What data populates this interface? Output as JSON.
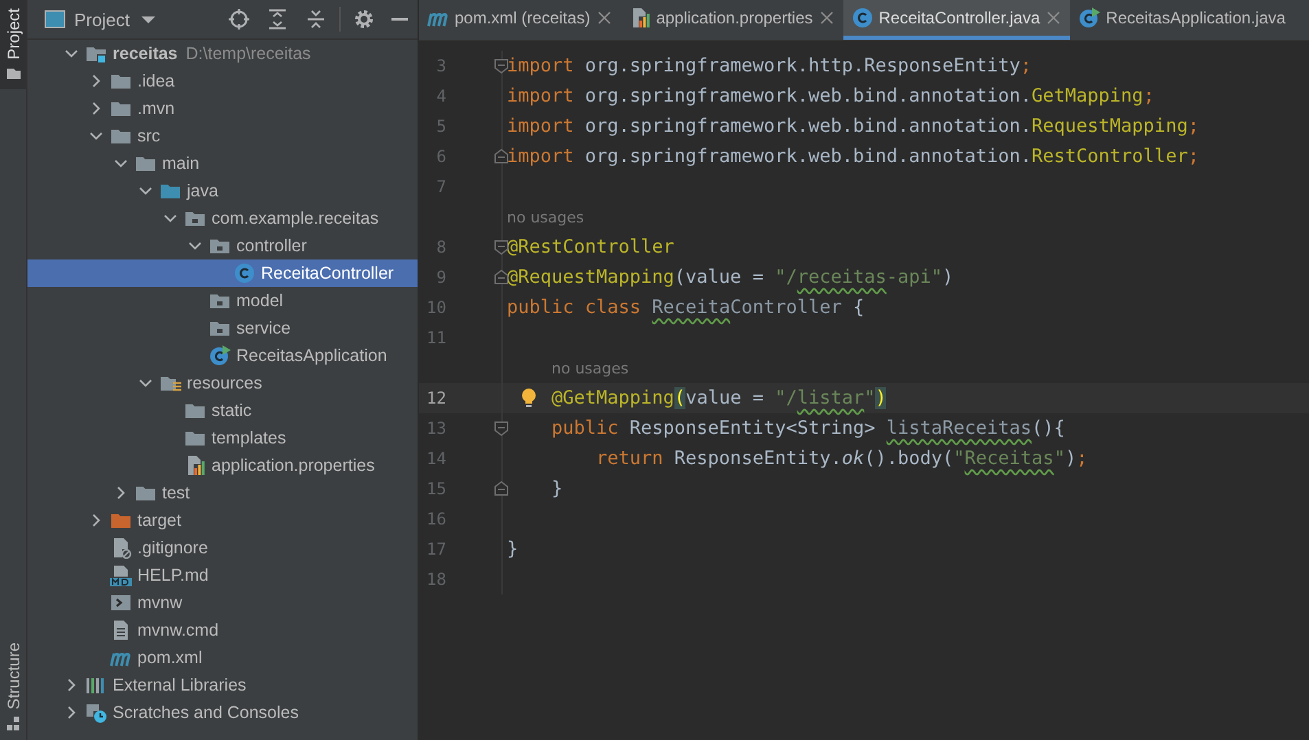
{
  "tool_strip": [
    {
      "label": "Project",
      "selected": true
    },
    {
      "label": "Structure",
      "selected": false
    }
  ],
  "project_panel": {
    "view": "Project",
    "tree": [
      {
        "label": "receitas",
        "path": "D:\\temp\\receitas",
        "kind": "module",
        "expanded": true,
        "selected": false,
        "children": [
          {
            "label": ".idea",
            "kind": "folder",
            "expanded": false,
            "selected": false
          },
          {
            "label": ".mvn",
            "kind": "folder",
            "expanded": false,
            "selected": false
          },
          {
            "label": "src",
            "kind": "folder",
            "expanded": true,
            "selected": false,
            "children": [
              {
                "label": "main",
                "kind": "folder",
                "expanded": true,
                "selected": false,
                "children": [
                  {
                    "label": "java",
                    "kind": "source-folder",
                    "expanded": true,
                    "selected": false,
                    "children": [
                      {
                        "label": "com.example.receitas",
                        "kind": "package",
                        "expanded": true,
                        "selected": false,
                        "children": [
                          {
                            "label": "controller",
                            "kind": "package",
                            "expanded": true,
                            "selected": false,
                            "children": [
                              {
                                "label": "ReceitaController",
                                "kind": "class",
                                "selected": true
                              }
                            ]
                          },
                          {
                            "label": "model",
                            "kind": "package",
                            "selected": false
                          },
                          {
                            "label": "service",
                            "kind": "package",
                            "selected": false
                          },
                          {
                            "label": "ReceitasApplication",
                            "kind": "app-class",
                            "selected": false
                          }
                        ]
                      }
                    ]
                  },
                  {
                    "label": "resources",
                    "kind": "resources-folder",
                    "expanded": true,
                    "selected": false,
                    "children": [
                      {
                        "label": "static",
                        "kind": "folder",
                        "selected": false
                      },
                      {
                        "label": "templates",
                        "kind": "folder",
                        "selected": false
                      },
                      {
                        "label": "application.properties",
                        "kind": "properties",
                        "selected": false
                      }
                    ]
                  }
                ]
              },
              {
                "label": "test",
                "kind": "folder",
                "expanded": false,
                "selected": false
              }
            ]
          },
          {
            "label": "target",
            "kind": "excluded-folder",
            "expanded": false,
            "selected": false
          },
          {
            "label": ".gitignore",
            "kind": "ignore-file",
            "selected": false
          },
          {
            "label": "HELP.md",
            "kind": "markdown",
            "selected": false
          },
          {
            "label": "mvnw",
            "kind": "shell",
            "selected": false
          },
          {
            "label": "mvnw.cmd",
            "kind": "text-file",
            "selected": false
          },
          {
            "label": "pom.xml",
            "kind": "maven",
            "selected": false
          }
        ]
      },
      {
        "label": "External Libraries",
        "kind": "libraries",
        "expanded": false,
        "selected": false
      },
      {
        "label": "Scratches and Consoles",
        "kind": "scratches",
        "expanded": false,
        "selected": false
      }
    ]
  },
  "editor_tabs": [
    {
      "label": "pom.xml (receitas)",
      "kind": "maven",
      "selected": false,
      "close_button": true
    },
    {
      "label": "application.properties",
      "kind": "properties",
      "selected": false,
      "close_button": true
    },
    {
      "label": "ReceitaController.java",
      "kind": "class",
      "selected": true,
      "close_button": true
    },
    {
      "label": "ReceitasApplication.java",
      "kind": "app-class",
      "selected": false,
      "close_button": false
    }
  ],
  "editor": {
    "lines": [
      {
        "number": "3",
        "kind": "fold-start",
        "tokens": [
          {
            "kind": "keyword",
            "text": "import"
          },
          {
            "kind": "plain",
            "text": " org.springframework.http.ResponseEntity"
          },
          {
            "kind": "keyword",
            "text": ";"
          }
        ]
      },
      {
        "number": "4",
        "kind": "code",
        "tokens": [
          {
            "kind": "keyword",
            "text": "import"
          },
          {
            "kind": "plain",
            "text": " org.springframework.web.bind.annotation."
          },
          {
            "kind": "annotation",
            "text": "GetMapping"
          },
          {
            "kind": "keyword",
            "text": ";"
          }
        ]
      },
      {
        "number": "5",
        "kind": "code",
        "tokens": [
          {
            "kind": "keyword",
            "text": "import"
          },
          {
            "kind": "plain",
            "text": " org.springframework.web.bind.annotation."
          },
          {
            "kind": "annotation",
            "text": "RequestMapping"
          },
          {
            "kind": "keyword",
            "text": ";"
          }
        ]
      },
      {
        "number": "6",
        "kind": "fold-end",
        "tokens": [
          {
            "kind": "keyword",
            "text": "import"
          },
          {
            "kind": "plain",
            "text": " org.springframework.web.bind.annotation."
          },
          {
            "kind": "annotation",
            "text": "RestController"
          },
          {
            "kind": "keyword",
            "text": ";"
          }
        ]
      },
      {
        "number": "7",
        "kind": "code"
      },
      {
        "number": "8",
        "kind": "fold-start",
        "hint": "no usages",
        "tokens": [
          {
            "kind": "annotation",
            "text": "@RestController"
          }
        ]
      },
      {
        "number": "9",
        "kind": "fold-end",
        "tokens": [
          {
            "kind": "annotation",
            "text": "@RequestMapping"
          },
          {
            "kind": "plain",
            "text": "(value = "
          },
          {
            "kind": "string",
            "text": "\"/"
          },
          {
            "kind": "string",
            "text": "receitas",
            "typo": true
          },
          {
            "kind": "string",
            "text": "-api\""
          },
          {
            "kind": "plain",
            "text": ")"
          }
        ]
      },
      {
        "number": "10",
        "kind": "code",
        "tokens": [
          {
            "kind": "keyword",
            "text": "public class "
          },
          {
            "kind": "unused",
            "text": "Receita",
            "typo": true
          },
          {
            "kind": "unused",
            "text": "Controller"
          },
          {
            "kind": "plain",
            "text": " {"
          }
        ]
      },
      {
        "number": "11",
        "kind": "code"
      },
      {
        "number": "12",
        "kind": "code",
        "hint": "no usages",
        "current": true,
        "bulb": true,
        "tokens": [
          {
            "kind": "annotation",
            "text": "    @GetMapping"
          },
          {
            "kind": "brace-match",
            "text": "("
          },
          {
            "kind": "plain",
            "text": "value = "
          },
          {
            "kind": "string",
            "text": "\"/"
          },
          {
            "kind": "string",
            "text": "listar",
            "typo": true
          },
          {
            "kind": "string",
            "text": "\""
          },
          {
            "kind": "brace-match",
            "text": ")"
          }
        ]
      },
      {
        "number": "13",
        "kind": "fold-start",
        "tokens": [
          {
            "kind": "keyword",
            "text": "    public "
          },
          {
            "kind": "plain",
            "text": "ResponseEntity<String> "
          },
          {
            "kind": "unused",
            "text": "listaReceitas",
            "typo": true
          },
          {
            "kind": "plain",
            "text": "(){"
          }
        ]
      },
      {
        "number": "14",
        "kind": "code",
        "tokens": [
          {
            "kind": "keyword",
            "text": "        return "
          },
          {
            "kind": "plain",
            "text": "ResponseEntity."
          },
          {
            "kind": "italic",
            "text": "ok"
          },
          {
            "kind": "plain",
            "text": "().body("
          },
          {
            "kind": "string",
            "text": "\""
          },
          {
            "kind": "string",
            "text": "Receitas",
            "typo": true
          },
          {
            "kind": "string",
            "text": "\""
          },
          {
            "kind": "plain",
            "text": ")"
          },
          {
            "kind": "keyword",
            "text": ";"
          }
        ]
      },
      {
        "number": "15",
        "kind": "fold-end",
        "tokens": [
          {
            "kind": "plain",
            "text": "    }"
          }
        ]
      },
      {
        "number": "16",
        "kind": "code"
      },
      {
        "number": "17",
        "kind": "code",
        "tokens": [
          {
            "kind": "plain",
            "text": "}"
          }
        ]
      },
      {
        "number": "18",
        "kind": "code"
      }
    ]
  }
}
